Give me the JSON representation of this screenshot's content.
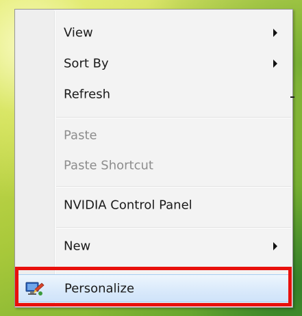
{
  "context_menu": {
    "items": [
      {
        "label": "View",
        "submenu": true,
        "enabled": true
      },
      {
        "label": "Sort By",
        "submenu": true,
        "enabled": true
      },
      {
        "label": "Refresh",
        "submenu": false,
        "enabled": true
      },
      {
        "label": "Paste",
        "submenu": false,
        "enabled": false
      },
      {
        "label": "Paste Shortcut",
        "submenu": false,
        "enabled": false
      },
      {
        "label": "NVIDIA Control Panel",
        "submenu": false,
        "enabled": true
      },
      {
        "label": "New",
        "submenu": true,
        "enabled": true
      },
      {
        "label": "Personalize",
        "submenu": false,
        "enabled": true,
        "icon": "personalize-icon",
        "highlighted": true
      }
    ]
  },
  "colors": {
    "annotation_box": "#e8100c",
    "hover_highlight": "#dcebfb",
    "disabled_text": "#8d8d8d"
  }
}
